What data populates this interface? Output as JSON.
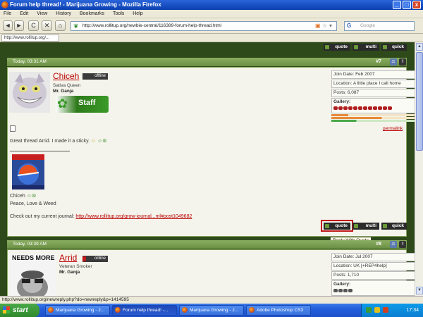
{
  "window": {
    "title": "Forum help thread! - Marijuana Growing - Mozilla Firefox",
    "controls": [
      "_",
      "□",
      "x"
    ]
  },
  "menu": [
    "File",
    "Edit",
    "View",
    "History",
    "Bookmarks",
    "Tools",
    "Help"
  ],
  "nav": {
    "back": "◄",
    "forward": "►",
    "reload": "C",
    "stop": "✕",
    "home": "⌂",
    "url": "http://www.rollitup.org/newbie-central/116389-forum-help-thread.html",
    "search_placeholder": "Google",
    "search_engine": "G"
  },
  "bookmark_tab": "http://www.rollitup.org/...",
  "buttons": {
    "quote": "quote",
    "multi": "multi",
    "quick": "quick"
  },
  "post7": {
    "time": "Today, 03:31 AM",
    "number": "#7",
    "username": "Chiceh",
    "status": "offline",
    "title": "Sativa Queen",
    "rank": "Mr. Ganja",
    "badge": "Staff",
    "join": "Join Date: Feb 2007",
    "location": "Location: A little place I call home",
    "posts": "Posts: 6,087",
    "gallery": "Gallery:",
    "permalink": "permalink",
    "message": "Great thread Arrid. I made it a sticky.",
    "sig_name": "Chiceh",
    "sig_line": "Peace, Love & Weed",
    "journal_prefix": "Check out my current journal:",
    "journal_link": "http://www.rollitup.org/grow-journal...ml#post1049682",
    "tooltip": "Reply With Quote"
  },
  "post8": {
    "time": "Today, 03:39 AM",
    "number": "#8",
    "username": "Arrid",
    "status": "online",
    "title": "Veteran Smoker",
    "rank": "Mr. Ganja",
    "join": "Join Date: Jul 2007",
    "location": "Location: UK [+REP4help]",
    "posts": "Posts: 1,710",
    "gallery": "Gallery:",
    "avatar_text": "NEEDS MORE"
  },
  "statusbar": "http://www.rollitup.org/newreply.php?do=newreply&p=1414595",
  "taskbar": {
    "start": "start",
    "tasks": [
      "Marijuana Growing - J...",
      "Forum help thread! -...",
      "Marijuana Growing - J...",
      "Adobe Photoshop CS3"
    ],
    "clock": "17:34"
  }
}
